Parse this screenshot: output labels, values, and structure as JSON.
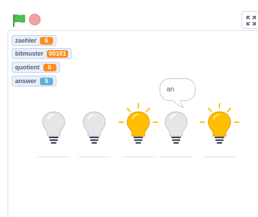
{
  "toolbar": {
    "flag_color": "#4cbf56",
    "stop_color": "#f1a3a3",
    "fullscreen_icon": "fullscreen-icon"
  },
  "monitors": [
    {
      "label": "zaehler",
      "value": "6",
      "color": "#ff8c1a"
    },
    {
      "label": "bitmuster",
      "value": "00101",
      "color": "#ff8c1a"
    },
    {
      "label": "quotient",
      "value": "0",
      "color": "#ff8c1a"
    },
    {
      "label": "answer",
      "value": "5",
      "color": "#5cb1d6"
    }
  ],
  "speech_bubble": {
    "text": "an"
  },
  "bulbs": [
    {
      "state": "off"
    },
    {
      "state": "off"
    },
    {
      "state": "on"
    },
    {
      "state": "off"
    },
    {
      "state": "on"
    }
  ],
  "colors": {
    "bulb_on": "#ffbf00",
    "bulb_off": "#d9d9d9",
    "base": "#3b3f58"
  }
}
